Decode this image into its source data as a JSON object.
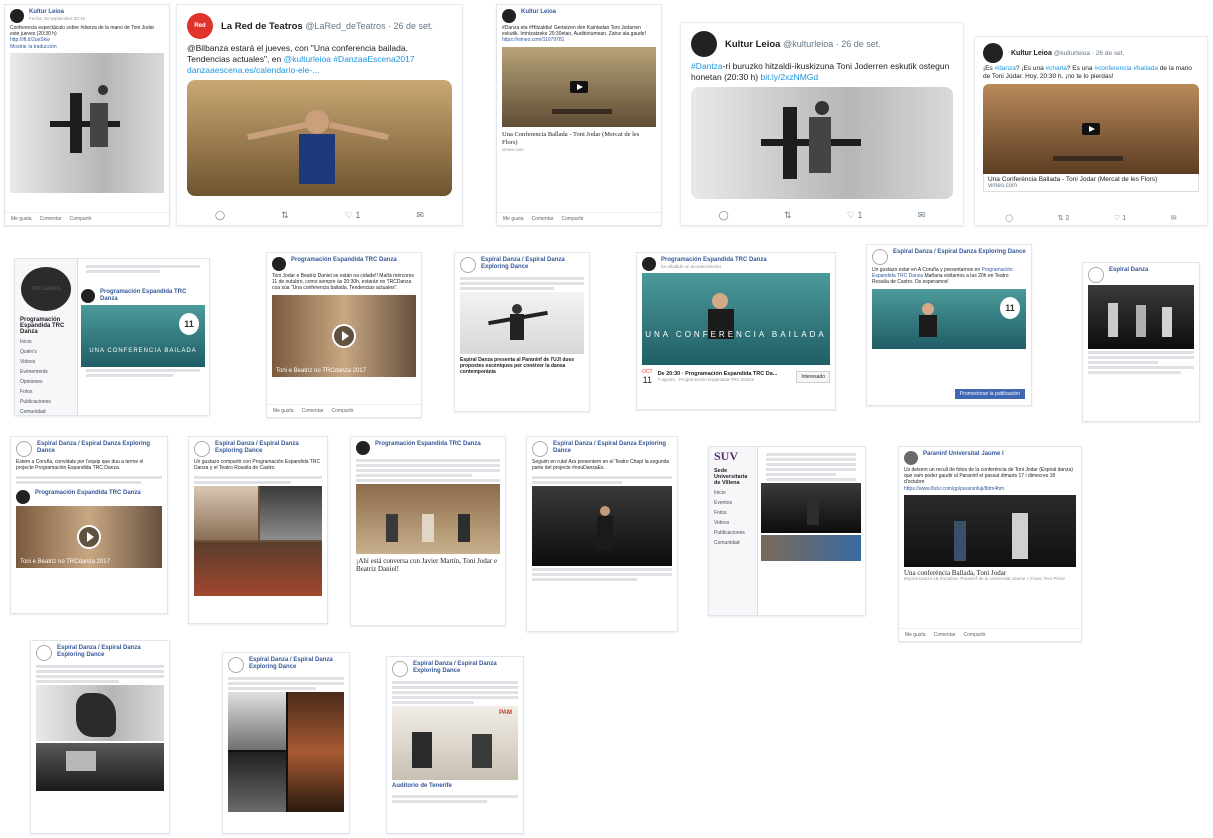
{
  "common": {
    "fb_like": "Me gusta",
    "fb_comment": "Comentar",
    "fb_share": "Compartir",
    "see_translation": "Mostrar la traducción",
    "mostrar_traduccion": "Mostrar la traducción"
  },
  "card1": {
    "name": "Kultur Leioa",
    "sub": "Fecha: 28 septiembre 20:15",
    "text": "Conferencia espectáculo sobre #danza de la mano de Toni Jodar este jueves (20:30 h)",
    "link": "http://ift.tt/2ueSkw"
  },
  "card2": {
    "name": "La Red de Teatros",
    "handle": "@LaRed_deTeatros · 26 de set.",
    "avatar": "Red",
    "text_pre": "@Bilbanza estará el jueves, con \"Una conferencia bailada. Tendencias actuales\", en ",
    "hashtags": "@kulturleioa #DanzaaEscena2017",
    "url": "danzaaescena.es/calendario-ele-...",
    "likes": "1"
  },
  "card3": {
    "name": "Kultur Leioa",
    "text": "#Danza eta #Hitzaldia! Gertatzen den Kaintadan Toni Jodarren eskutik. Irrintzatzeke 20:30etan, Auditoriumean. Zatoz ala gaude!",
    "link": "https://vimeo.com/11079781",
    "caption": "Una Conferencia Ballada - Toni Jodar (Mercat de les Flors)",
    "caption_sub": "vimeo.com"
  },
  "card4": {
    "name": "Kultur Leioa",
    "handle": "@kulturleioa · 26 de set.",
    "text_hash": "#Dantza",
    "text": "-ri buruzko hitzaldi-ikuskizuna Toni Joderren eskutik ostegun honetan (20:30 h)",
    "url": "bit.ly/2xzNMGd",
    "likes": "1"
  },
  "card5": {
    "name": "Kultur Leioa",
    "handle": "@kulturleioa · 26 de set.",
    "text_pre": "¡Es ",
    "hash1": "#danza",
    "text_mid": "? ¡Es una ",
    "hash2": "#charla",
    "text_mid2": "? Es una ",
    "hash3": "#conferencia",
    "text_mid3": " ",
    "hash4": "#bailada",
    "text_post": " de la mano de Toni Jodar. Hoy, 20:30 h, ¡no te lo pierdas!",
    "caption": "Una Conferència Ballada - Toni Jodar (Mercat de les Flors)",
    "caption_sub": "vimeo.com",
    "retweets": "2",
    "likes": "1"
  },
  "card6": {
    "logo": "TRC DANZA",
    "page_name": "Programación Espandida TRC Danza",
    "side_items": [
      "Inicio",
      "Quién's",
      "Videos",
      "Evénements",
      "Opiniones",
      "Fotos",
      "Publicaciones",
      "Comunidad"
    ],
    "post_name": "Programación Espandida TRC Danza",
    "day": "11",
    "conf": "UNA CONFERENCIA BAILADA"
  },
  "card7": {
    "name": "Programación Espandida TRC Danza",
    "text": "Toni Jodar e Beatriz Daniel se están na cidade!! Mañá mércores 11 de outubro, como sempre ás 20:30h, estarán no TRCDanza coa súa \"Una conferencia bailada. Tendencias actuales\".",
    "overlay": "Toni e Beatriz no TRCdanza 2017"
  },
  "card8": {
    "name": "Espiral Danza / Espiral Danza Exploring Dance",
    "text": "Espiral Danza presenta al Paraninf de l'UJI dues propostes escèniques per conèixer la dansa contemporània"
  },
  "card9": {
    "name": "Programación Espandida TRC Danza",
    "sub": "ha añadido un acontecimiento",
    "conf": "UNA CONFERENCIA BAILADA",
    "event_month": "OCT",
    "event_day": "11",
    "event_title": "De 20:30 · Programación Espandida TRC Da...",
    "event_sub": "7 agosto · Programación Espandida TRC Danza",
    "interested": "Interesado"
  },
  "card10": {
    "name": "Espiral Danza / Espiral Danza Exploring Dance",
    "text_pre": "Un gustazo estar en A Coruña y presentarnos en ",
    "link": "Programación Espandida TRC Danza",
    "text_post": " Mañana visitamos a las 20h en Teatro Rosalía de Castro. Os esperamos!",
    "day": "11",
    "promote": "Promocionar la publicación"
  },
  "card11": {
    "name": "Espiral Danza"
  },
  "card12": {
    "name": "Espiral Danza / Espiral Danza Exploring Dance",
    "text": "Estem a Coruña, convidats per l'equip que duu a terme el projecte Programación Espandida TRC Danza.",
    "shared_name": "Programación Espandida TRC Danza",
    "overlay": "Toni e Beatriz no TRCdanza 2017"
  },
  "card13": {
    "name": "Espiral Danza / Espiral Danza Exploring Dance",
    "text": "Un gustazo compartir con Programación Espandida TRC Danza y el Teatro Rosalía de Castro."
  },
  "card14": {
    "name": "Programación Espandida TRC Danza",
    "caption": "¡Ahí está conversa con Javier Martín, Toni Jodar e Beatriz Daniel!"
  },
  "card15": {
    "name": "Espiral Danza / Espiral Danza Exploring Dance",
    "text": "Seguim en ruta! Ara presentem en el Teatro Chapí la segunda parte del projecte #nouDansaEs."
  },
  "card16": {
    "logo": "SUV",
    "page_name": "Sede Universitaria de Villena",
    "side_items": [
      "Inicio",
      "Eventos",
      "Fotos",
      "Videos",
      "Publicaciones",
      "Comunidad"
    ]
  },
  "card17": {
    "name": "Paraninf Universitat Jaume I",
    "text": "Us deixem un recull de fotos de la conferència de Toni Jodar (Espiral danza) que vam poder gaudir al Paraninf el passat dimarts 17 i dimecres 18 d'octubre",
    "link": "https://www.flickr.com/gp/paraninfuji/8dm4bm",
    "caption": "Una conferència Ballada, Toni Jodar",
    "caption_sub": "Espiral Danza 18 d'octubre, Paraninf de la Universitat Jaume I. Fotos: Rex Pérez"
  },
  "card18": {
    "name": "Espiral Danza / Espiral Danza Exploring Dance"
  },
  "card19": {
    "name": "Espiral Danza / Espiral Danza Exploring Dance"
  },
  "card20": {
    "name": "Espiral Danza / Espiral Danza Exploring Dance",
    "shared": "Auditorio de Tenerife",
    "logo_text": "PAM"
  }
}
